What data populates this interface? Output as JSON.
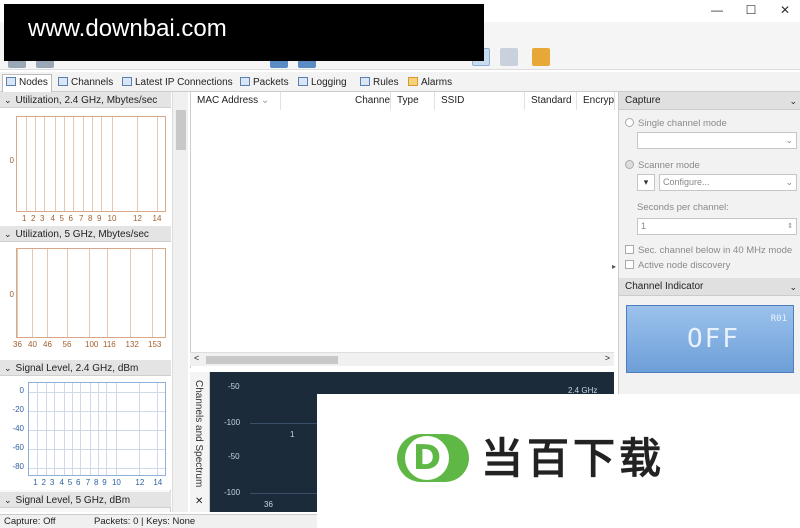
{
  "watermark": {
    "text": "www.downbai.com"
  },
  "window": {
    "minimize": "—",
    "maximize": "☐",
    "close": "✕"
  },
  "tabs": [
    {
      "label": "Nodes"
    },
    {
      "label": "Channels"
    },
    {
      "label": "Latest IP Connections"
    },
    {
      "label": "Packets"
    },
    {
      "label": "Logging"
    },
    {
      "label": "Rules"
    },
    {
      "label": "Alarms"
    }
  ],
  "left": {
    "util24": {
      "title": "Utilization, 2.4 GHz, Mbytes/sec",
      "y_tick": "0",
      "x_ticks": [
        "1",
        "2",
        "3",
        "4",
        "5",
        "6",
        "7",
        "8",
        "9",
        "10",
        "12",
        "14"
      ]
    },
    "util5": {
      "title": "Utilization, 5 GHz, Mbytes/sec",
      "y_tick": "0",
      "x_ticks": [
        "36",
        "40",
        "46",
        "56",
        "100",
        "116",
        "132",
        "153"
      ]
    },
    "sig24": {
      "title": "Signal Level, 2.4 GHz, dBm",
      "y_ticks": [
        "0",
        "-20",
        "-40",
        "-60",
        "-80"
      ],
      "x_ticks": [
        "1",
        "2",
        "3",
        "4",
        "5",
        "6",
        "7",
        "8",
        "9",
        "10",
        "12",
        "14"
      ]
    },
    "sig5": {
      "title": "Signal Level, 5 GHz, dBm"
    }
  },
  "grid": {
    "columns": [
      "MAC Address",
      "Channel",
      "Type",
      "SSID",
      "Standard",
      "Encryp"
    ],
    "scroll_left": "<",
    "scroll_right": ">"
  },
  "spectrum": {
    "side_label": "Channels and Spectrum",
    "close": "✕",
    "band_label": "2.4 GHz",
    "y_ticks_top": [
      "-50",
      "-100"
    ],
    "y_ticks_bottom": [
      "-50",
      "-100"
    ],
    "x_tick_top": "1",
    "x_tick_bottom": "36"
  },
  "capture": {
    "title": "Capture",
    "single_mode": "Single channel mode",
    "scanner_mode": "Scanner mode",
    "configure": "Configure...",
    "seconds_label": "Seconds per channel:",
    "seconds_value": "1",
    "sec_channel": "Sec. channel below in 40 MHz mode",
    "active_node": "Active node discovery"
  },
  "channel_indicator": {
    "title": "Channel Indicator",
    "display": "OFF",
    "code": "R01"
  },
  "status": {
    "capture": "Capture: Off",
    "packets": "Packets: 0 | Keys: None"
  },
  "logo": {
    "text": "当百下载",
    "letter": "D"
  }
}
